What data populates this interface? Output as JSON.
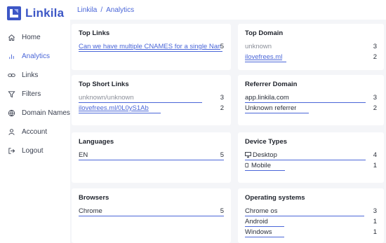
{
  "app": {
    "name": "Linkila",
    "brand_color": "#3d57c6",
    "accent": "#4a66d8"
  },
  "breadcrumb": {
    "root": "Linkila",
    "separator": "/",
    "current": "Analytics"
  },
  "sidebar": {
    "items": [
      {
        "label": "Home",
        "icon": "home-icon"
      },
      {
        "label": "Analytics",
        "icon": "analytics-icon",
        "active": true
      },
      {
        "label": "Links",
        "icon": "link-icon"
      },
      {
        "label": "Filters",
        "icon": "filter-icon"
      },
      {
        "label": "Domain Names",
        "icon": "globe-icon"
      },
      {
        "label": "Account",
        "icon": "user-icon"
      },
      {
        "label": "Logout",
        "icon": "logout-icon"
      }
    ]
  },
  "cards": {
    "top_links": {
      "title": "Top Links",
      "rows": [
        {
          "label": "Can we have multiple CNAMES for a single Name",
          "value": "5",
          "share": 1.0
        }
      ]
    },
    "top_domain": {
      "title": "Top Domain",
      "rows": [
        {
          "label": "unknown",
          "value": "3",
          "share": 1.0
        },
        {
          "label": "ilovefrees.ml",
          "value": "2",
          "share": 0.33
        }
      ]
    },
    "top_short_links": {
      "title": "Top Short Links",
      "rows": [
        {
          "label": "unknown/unknown",
          "value": "3",
          "share": 0.9
        },
        {
          "label": "ilovefrees.ml/0L0yS1Ab",
          "value": "2",
          "share": 0.6
        }
      ]
    },
    "referrer_domain": {
      "title": "Referrer Domain",
      "rows": [
        {
          "label": "app.linkila.com",
          "value": "3",
          "share": 1.0
        },
        {
          "label": "Unknown referrer",
          "value": "2",
          "share": 0.53
        }
      ]
    },
    "languages": {
      "title": "Languages",
      "rows": [
        {
          "label": "EN",
          "value": "5",
          "share": 1.0
        }
      ]
    },
    "device_types": {
      "title": "Device Types",
      "rows": [
        {
          "label": "Desktop",
          "value": "4",
          "icon": "desktop-icon",
          "share": 1.0
        },
        {
          "label": "Mobile",
          "value": "1",
          "icon": "mobile-icon",
          "share": 0.33
        }
      ]
    },
    "browsers": {
      "title": "Browsers",
      "rows": [
        {
          "label": "Chrome",
          "value": "5",
          "share": 1.0
        }
      ]
    },
    "operating_systems": {
      "title": "Operating systems",
      "rows": [
        {
          "label": "Chrome os",
          "value": "3",
          "share": 1.0
        },
        {
          "label": "Android",
          "value": "1",
          "share": 0.33
        },
        {
          "label": "Windows",
          "value": "1",
          "share": 0.33
        }
      ]
    }
  }
}
